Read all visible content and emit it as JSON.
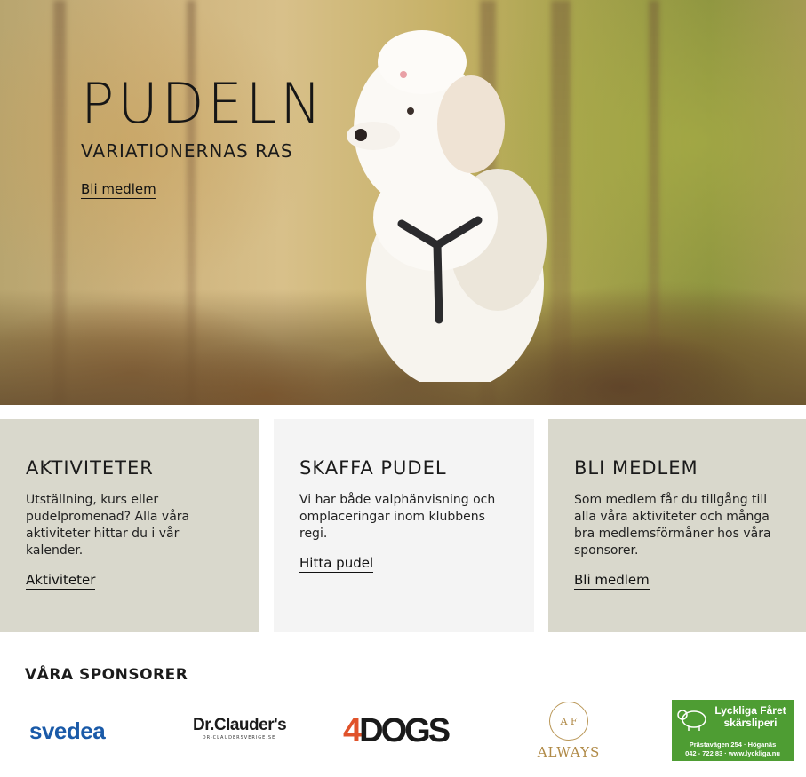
{
  "hero": {
    "title": "PUDELN",
    "subtitle": "VARIATIONERNAS RAS",
    "cta_label": "Bli medlem"
  },
  "cards": [
    {
      "title": "AKTIVITETER",
      "text": "Utställning, kurs eller pudelpromenad? Alla våra aktiviteter hittar du i vår kalender.",
      "link_label": "Aktiviteter",
      "background": "#d9d8cc"
    },
    {
      "title": "SKAFFA PUDEL",
      "text": "Vi har både valphänvisning och omplaceringar inom klubbens regi.",
      "link_label": "Hitta pudel",
      "background": "#f4f4f4"
    },
    {
      "title": "BLI MEDLEM",
      "text": "Som medlem får du tillgång till alla våra aktiviteter och många bra medlemsförmåner hos våra sponsorer.",
      "link_label": "Bli medlem",
      "background": "#d9d8cc"
    }
  ],
  "sponsors": {
    "title": "VÅRA SPONSORER",
    "logos": [
      {
        "name": "svedea",
        "text": "svedea",
        "color": "#1a5aa8"
      },
      {
        "name": "dr-clauders",
        "text": "Dr.Clauder's",
        "subtext": "DR-CLAUDERSVERIGE.SE"
      },
      {
        "name": "4dogs",
        "text_accent": "4",
        "text": "DOGS",
        "accent_color": "#e0522a"
      },
      {
        "name": "always",
        "emblem": "A F",
        "text": "ALWAYS",
        "color": "#b08a47"
      },
      {
        "name": "lyckliga-faret",
        "text": "Lyckliga Fåret skärsliperi",
        "address": "Prästavägen 254 · Höganäs",
        "contact": "042 - 722 83 · www.lyckliga.nu",
        "color": "#4e9d33"
      }
    ]
  }
}
